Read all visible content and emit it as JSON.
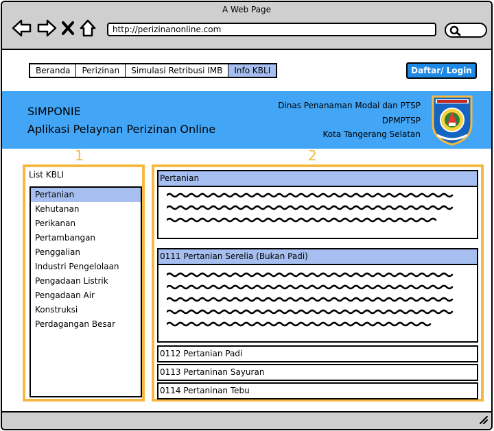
{
  "window": {
    "title": "A Web Page"
  },
  "browser": {
    "url": "http://perizinanonline.com"
  },
  "nav": {
    "tabs": [
      "Beranda",
      "Perizinan",
      "Simulasi Retribusi IMB",
      "Info KBLI"
    ],
    "active_tab": "Info KBLI",
    "login_label": "Daftar/ Login"
  },
  "banner": {
    "title": "SIMPONIE",
    "subtitle": "Aplikasi Pelaynan Perizinan Online",
    "agency_line1": "Dinas Penanaman Modal dan PTSP",
    "agency_line2": "DPMPTSP",
    "agency_line3": "Kota Tangerang Selatan"
  },
  "markers": {
    "left": "1",
    "right": "2"
  },
  "sidebar": {
    "title": "List KBLI",
    "selected": "Pertanian",
    "items": [
      "Pertanian",
      "Kehutanan",
      "Perikanan",
      "Pertambangan",
      "Penggalian",
      "Industri Pengelolaan",
      "Pengadaan Listrik",
      "Pengadaan Air",
      "Konstruksi",
      "Perdagangan Besar"
    ]
  },
  "detail": {
    "section_title": "Pertanian",
    "items": [
      "0111 Pertanian Serelia (Bukan Padi)",
      "0112 Pertanian Padi",
      "0113 Pertaninan Sayuran",
      "0114 Pertaninan Tebu"
    ]
  },
  "colors": {
    "banner": "#42a5f5",
    "button": "#1e88e5",
    "highlight": "#a6bff0",
    "panel_border": "#f5b942"
  }
}
